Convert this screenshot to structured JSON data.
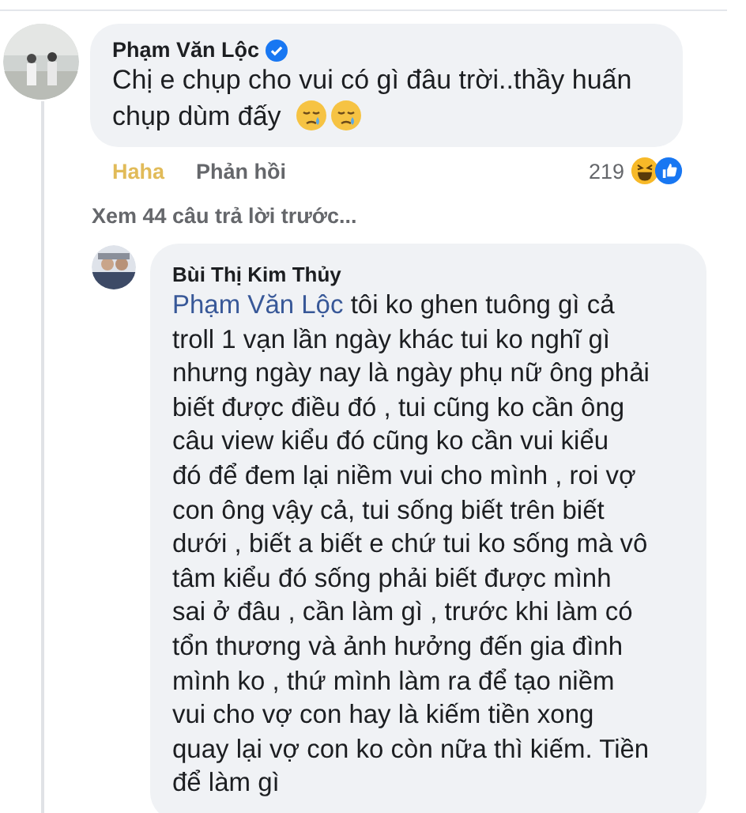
{
  "comment": {
    "author": "Phạm Văn Lộc",
    "verified": true,
    "text_lines": [
      "Chị e chụp cho vui có gì đâu trời..thầy huấn",
      "chụp dùm đấy"
    ],
    "emojis": [
      {
        "kind": "crying"
      },
      {
        "kind": "crying"
      }
    ],
    "actions": [
      {
        "label": "Haha",
        "selected": true
      },
      {
        "label": "Phản hồi",
        "selected": false
      }
    ],
    "reaction_count": "219"
  },
  "view_previous": "Xem 44 câu trả lời trước...",
  "reply": {
    "author": "Bùi Thị Kim Thủy",
    "mention": "Phạm Văn Lộc",
    "first_line": "tôi ko ghen tuông gì cả",
    "text_lines": [
      "troll 1 vạn lần ngày khác tui ko nghĩ gì",
      "nhưng ngày nay là ngày phụ nữ ông phải",
      "biết được điều đó , tui cũng ko cần ông",
      "câu view kiểu đó cũng ko cần vui kiểu",
      "đó để đem lại niềm vui cho mình , roi vợ",
      "con ông vậy cả, tui sống biết trên biết",
      "dưới , biết a biết e chứ tui ko sống mà vô",
      "tâm kiểu đó sống phải biết được mình",
      "sai ở đâu , cần làm gì , trước khi làm có",
      "tổn thương và ảnh hưởng đến gia đình",
      "mình ko , thứ mình làm ra để tạo niềm",
      "vui cho vợ con hay là kiếm tiền xong",
      "quay lại vợ con ko còn nữa thì kiếm. Tiền",
      "để làm gì"
    ]
  }
}
